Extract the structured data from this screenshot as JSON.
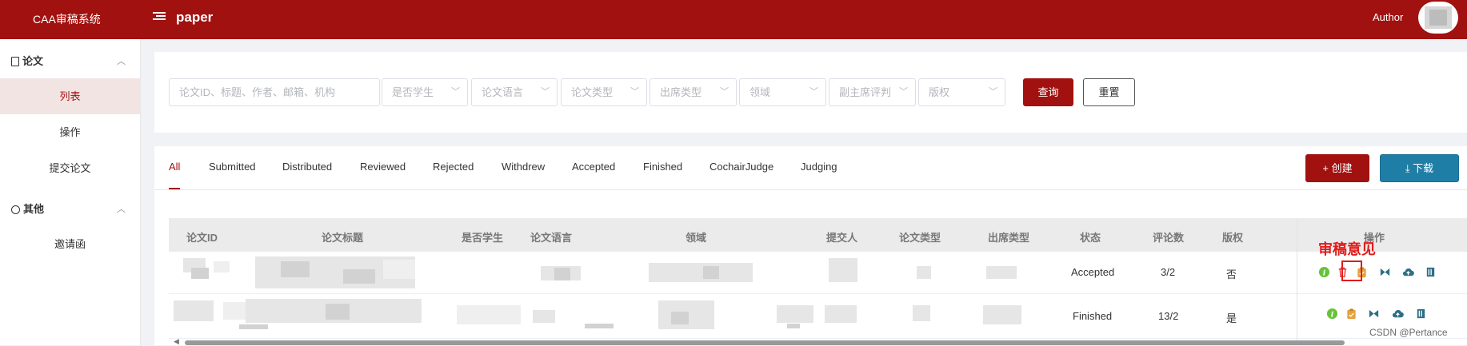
{
  "app": {
    "title": "CAA审稿系统",
    "page": "paper",
    "role": "Author"
  },
  "sidebar": {
    "sections": [
      {
        "label": "论文",
        "items": [
          {
            "label": "列表",
            "active": true
          },
          {
            "label": "操作"
          },
          {
            "label": "提交论文"
          }
        ]
      },
      {
        "label": "其他",
        "items": [
          {
            "label": "邀请函"
          }
        ]
      }
    ]
  },
  "filters": {
    "search_placeholder": "论文ID、标题、作者、邮箱、机构",
    "selects": [
      "是否学生",
      "论文语言",
      "论文类型",
      "出席类型",
      "领域",
      "副主席评判",
      "版权"
    ],
    "query_label": "查询",
    "reset_label": "重置"
  },
  "tabs": [
    "All",
    "Submitted",
    "Distributed",
    "Reviewed",
    "Rejected",
    "Withdrew",
    "Accepted",
    "Finished",
    "CochairJudge",
    "Judging"
  ],
  "active_tab": "All",
  "actions": {
    "create_label": "+ 创建",
    "download_label": "⤓ 下载"
  },
  "table": {
    "columns": [
      "论文ID",
      "论文标题",
      "是否学生",
      "论文语言",
      "领域",
      "提交人",
      "论文类型",
      "出席类型",
      "状态",
      "评论数",
      "版权",
      "操作"
    ],
    "rows": [
      {
        "status": "Accepted",
        "comments": "3/2",
        "copyright": "否"
      },
      {
        "status": "Finished",
        "comments": "13/2",
        "copyright": "是"
      }
    ]
  },
  "annotation": {
    "label": "审稿意见"
  },
  "watermark": "CSDN @Pertance",
  "colors": {
    "brand": "#a1110f",
    "download": "#1f7ea5",
    "annotation": "#e21c1c"
  }
}
